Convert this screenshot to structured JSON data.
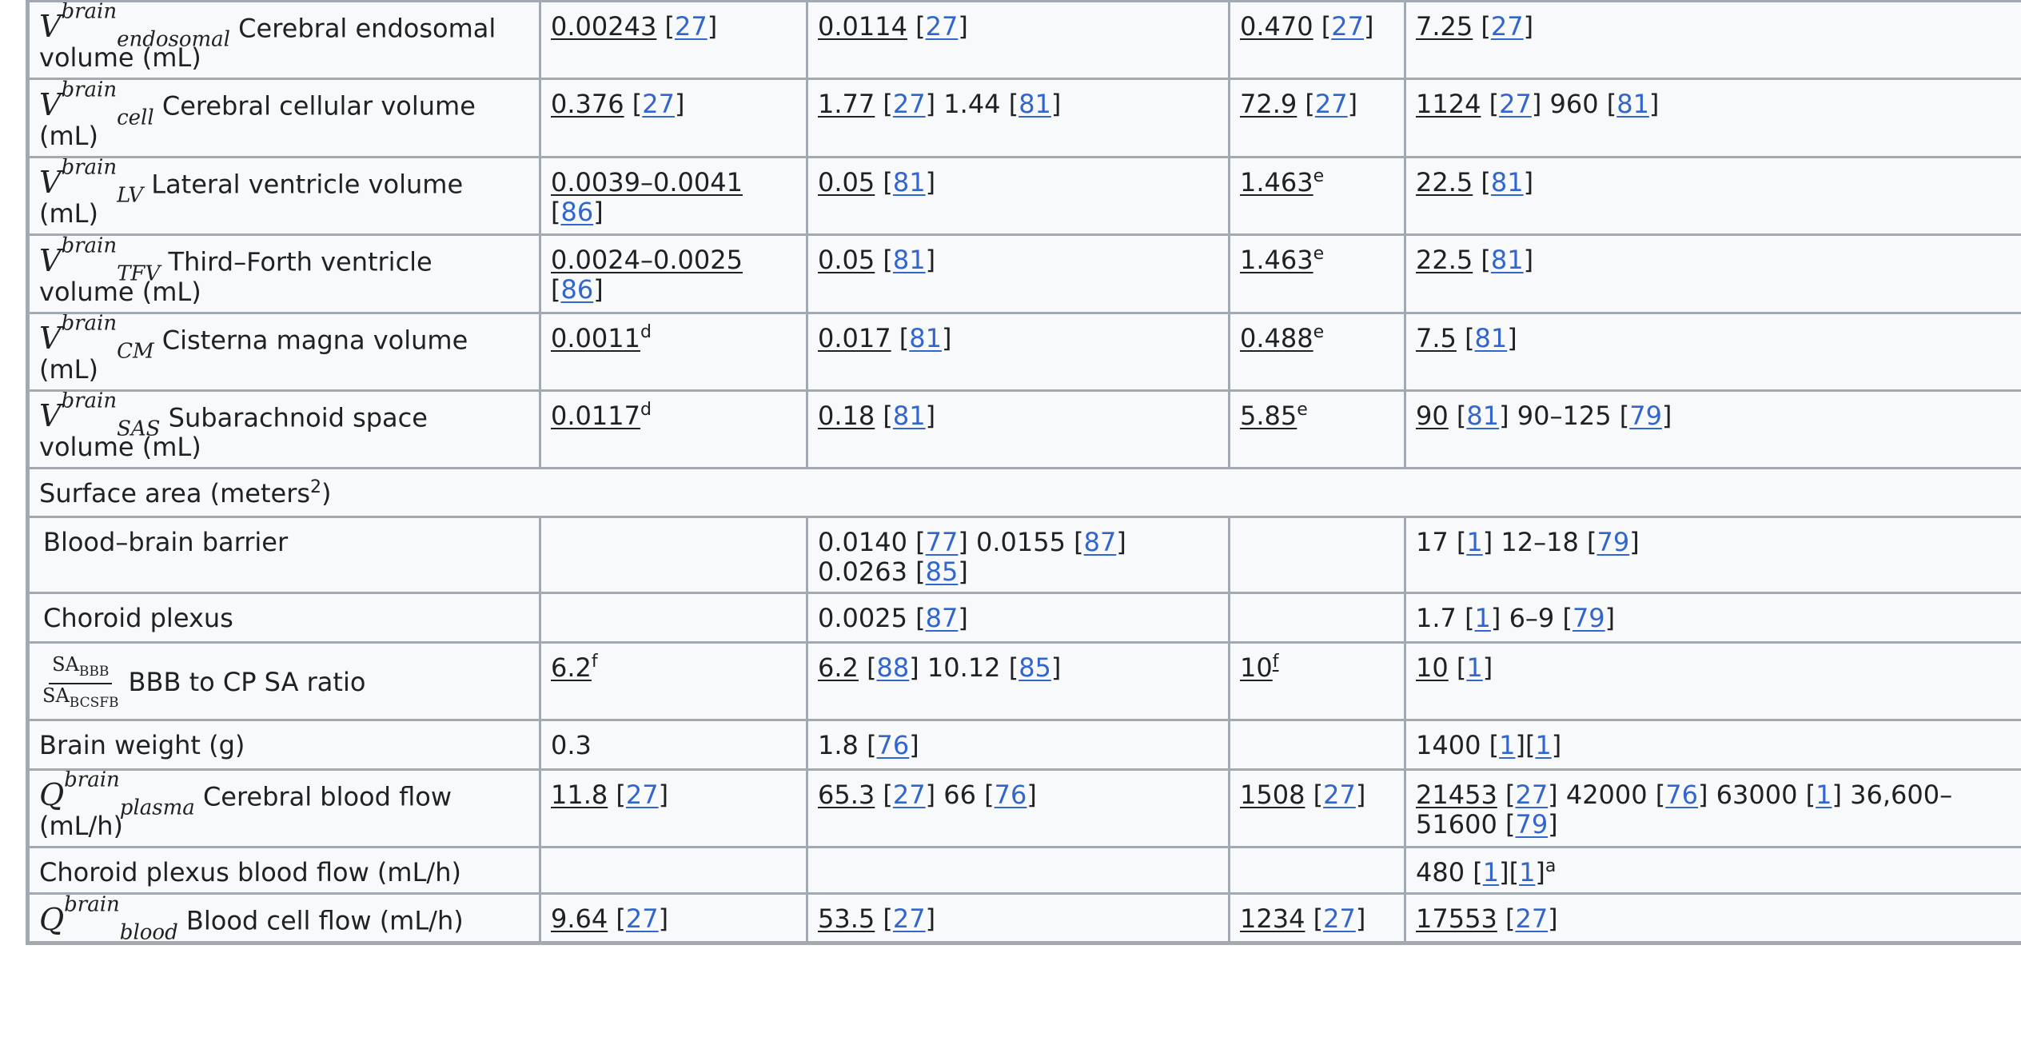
{
  "rows": [
    {
      "sym_base": "V",
      "sym_sup": "brain",
      "sym_sub": "endosomal",
      "label": "Cerebral endosomal volume (mL)",
      "cells": [
        [
          {
            "t": "0.00243",
            "u": true
          },
          {
            "t": " ["
          },
          {
            "r": "27"
          },
          {
            "t": "]"
          }
        ],
        [
          {
            "t": "0.0114",
            "u": true
          },
          {
            "t": " ["
          },
          {
            "r": "27"
          },
          {
            "t": "]"
          }
        ],
        [
          {
            "t": "0.470",
            "u": true
          },
          {
            "t": " ["
          },
          {
            "r": "27"
          },
          {
            "t": "]"
          }
        ],
        [
          {
            "t": "7.25",
            "u": true
          },
          {
            "t": " ["
          },
          {
            "r": "27"
          },
          {
            "t": "]"
          }
        ]
      ]
    },
    {
      "sym_base": "V",
      "sym_sup": "brain",
      "sym_sub": "cell",
      "label": "Cerebral cellular volume (mL)",
      "cells": [
        [
          {
            "t": "0.376",
            "u": true
          },
          {
            "t": " ["
          },
          {
            "r": "27"
          },
          {
            "t": "]"
          }
        ],
        [
          {
            "t": "1.77",
            "u": true
          },
          {
            "t": " ["
          },
          {
            "r": "27"
          },
          {
            "t": "] 1.44 ["
          },
          {
            "r": "81"
          },
          {
            "t": "]"
          }
        ],
        [
          {
            "t": "72.9",
            "u": true
          },
          {
            "t": " ["
          },
          {
            "r": "27"
          },
          {
            "t": "]"
          }
        ],
        [
          {
            "t": "1124",
            "u": true
          },
          {
            "t": " ["
          },
          {
            "r": "27"
          },
          {
            "t": "] 960 ["
          },
          {
            "r": "81"
          },
          {
            "t": "]"
          }
        ]
      ]
    },
    {
      "sym_base": "V",
      "sym_sup": "brain",
      "sym_sub": "LV",
      "label": "Lateral ventricle volume (mL)",
      "cells": [
        [
          {
            "t": "0.0039–0.0041",
            "u": true
          },
          {
            "t": " ["
          },
          {
            "r": "86"
          },
          {
            "t": "]"
          }
        ],
        [
          {
            "t": "0.05",
            "u": true
          },
          {
            "t": " ["
          },
          {
            "r": "81"
          },
          {
            "t": "]"
          }
        ],
        [
          {
            "t": "1.463",
            "u": true
          },
          {
            "s": "e"
          }
        ],
        [
          {
            "t": "22.5",
            "u": true
          },
          {
            "t": " ["
          },
          {
            "r": "81"
          },
          {
            "t": "]"
          }
        ]
      ]
    },
    {
      "sym_base": "V",
      "sym_sup": "brain",
      "sym_sub": "TFV",
      "label": "Third–Forth ventricle volume (mL)",
      "cells": [
        [
          {
            "t": "0.0024–0.0025",
            "u": true
          },
          {
            "t": " ["
          },
          {
            "r": "86"
          },
          {
            "t": "]"
          }
        ],
        [
          {
            "t": "0.05",
            "u": true
          },
          {
            "t": " ["
          },
          {
            "r": "81"
          },
          {
            "t": "]"
          }
        ],
        [
          {
            "t": "1.463",
            "u": true
          },
          {
            "s": "e"
          }
        ],
        [
          {
            "t": "22.5",
            "u": true
          },
          {
            "t": " ["
          },
          {
            "r": "81"
          },
          {
            "t": "]"
          }
        ]
      ]
    },
    {
      "sym_base": "V",
      "sym_sup": "brain",
      "sym_sub": "CM",
      "label": "Cisterna magna volume (mL)",
      "cells": [
        [
          {
            "t": "0.0011",
            "u": true
          },
          {
            "s": "d"
          }
        ],
        [
          {
            "t": "0.017",
            "u": true
          },
          {
            "t": " ["
          },
          {
            "r": "81"
          },
          {
            "t": "]"
          }
        ],
        [
          {
            "t": "0.488",
            "u": true
          },
          {
            "s": "e"
          }
        ],
        [
          {
            "t": "7.5",
            "u": true
          },
          {
            "t": " ["
          },
          {
            "r": "81"
          },
          {
            "t": "]"
          }
        ]
      ]
    },
    {
      "sym_base": "V",
      "sym_sup": "brain",
      "sym_sub": "SAS",
      "label": "Subarachnoid space volume (mL)",
      "cells": [
        [
          {
            "t": "0.0117",
            "u": true
          },
          {
            "s": "d"
          }
        ],
        [
          {
            "t": "0.18",
            "u": true
          },
          {
            "t": " ["
          },
          {
            "r": "81"
          },
          {
            "t": "]"
          }
        ],
        [
          {
            "t": "5.85",
            "u": true
          },
          {
            "s": "e"
          }
        ],
        [
          {
            "t": "90",
            "u": true
          },
          {
            "t": " ["
          },
          {
            "r": "81"
          },
          {
            "t": "] 90–125 ["
          },
          {
            "r": "79"
          },
          {
            "t": "]"
          }
        ]
      ]
    },
    {
      "section": true,
      "label_parts": [
        {
          "t": "Surface area (meters"
        },
        {
          "s": "2"
        },
        {
          "t": ")"
        }
      ]
    },
    {
      "indent": true,
      "label": "Blood–brain barrier",
      "cells": [
        [],
        [
          {
            "t": "0.0140 ["
          },
          {
            "r": "77"
          },
          {
            "t": "] 0.0155 ["
          },
          {
            "r": "87"
          },
          {
            "t": "] 0.0263 ["
          },
          {
            "r": "85"
          },
          {
            "t": "]"
          }
        ],
        [],
        [
          {
            "t": "17 ["
          },
          {
            "r": "1"
          },
          {
            "t": "] 12–18 ["
          },
          {
            "r": "79"
          },
          {
            "t": "]"
          }
        ]
      ]
    },
    {
      "indent": true,
      "label": "Choroid plexus",
      "cells": [
        [],
        [
          {
            "t": "0.0025 ["
          },
          {
            "r": "87"
          },
          {
            "t": "]"
          }
        ],
        [],
        [
          {
            "t": "1.7 ["
          },
          {
            "r": "1"
          },
          {
            "t": "] 6–9 ["
          },
          {
            "r": "79"
          },
          {
            "t": "]"
          }
        ]
      ]
    },
    {
      "frac_num": "SA",
      "frac_num_sub": "BBB",
      "frac_den": "SA",
      "frac_den_sub": "BCSFB",
      "label": "BBB to CP SA ratio",
      "cells": [
        [
          {
            "t": "6.2",
            "u": true
          },
          {
            "s": "f"
          }
        ],
        [
          {
            "t": "6.2",
            "u": true
          },
          {
            "t": " ["
          },
          {
            "r": "88"
          },
          {
            "t": "] 10.12 ["
          },
          {
            "r": "85"
          },
          {
            "t": "]"
          }
        ],
        [
          {
            "t": "10",
            "u": true
          },
          {
            "s": "f",
            "u": true
          }
        ],
        [
          {
            "t": "10",
            "u": true
          },
          {
            "t": " ["
          },
          {
            "r": "1"
          },
          {
            "t": "]"
          }
        ]
      ]
    },
    {
      "label": "Brain weight (g)",
      "cells": [
        [
          {
            "t": "0.3"
          }
        ],
        [
          {
            "t": "1.8 ["
          },
          {
            "r": "76"
          },
          {
            "t": "]"
          }
        ],
        [],
        [
          {
            "t": "1400 ["
          },
          {
            "r": "1"
          },
          {
            "t": "]["
          },
          {
            "r": "1"
          },
          {
            "t": "]"
          }
        ]
      ]
    },
    {
      "sym_base": "Q",
      "sym_sup": "brain",
      "sym_sub": "plasma",
      "label": "Cerebral blood flow (mL/h)",
      "cells": [
        [
          {
            "t": "11.8",
            "u": true
          },
          {
            "t": " ["
          },
          {
            "r": "27"
          },
          {
            "t": "]"
          }
        ],
        [
          {
            "t": "65.3",
            "u": true
          },
          {
            "t": " ["
          },
          {
            "r": "27"
          },
          {
            "t": "] 66 ["
          },
          {
            "r": "76"
          },
          {
            "t": "]"
          }
        ],
        [
          {
            "t": "1508",
            "u": true
          },
          {
            "t": " ["
          },
          {
            "r": "27"
          },
          {
            "t": "]"
          }
        ],
        [
          {
            "t": "21453",
            "u": true
          },
          {
            "t": " ["
          },
          {
            "r": "27"
          },
          {
            "t": "] 42000 ["
          },
          {
            "r": "76"
          },
          {
            "t": "] 63000 ["
          },
          {
            "r": "1"
          },
          {
            "t": "] 36,600–51600 ["
          },
          {
            "r": "79"
          },
          {
            "t": "]"
          }
        ]
      ]
    },
    {
      "label": "Choroid plexus blood flow (mL/h)",
      "cells": [
        [],
        [],
        [],
        [
          {
            "t": "480 ["
          },
          {
            "r": "1"
          },
          {
            "t": "]["
          },
          {
            "r": "1"
          },
          {
            "t": "]"
          },
          {
            "s": "a"
          }
        ]
      ]
    },
    {
      "sym_base": "Q",
      "sym_sup": "brain",
      "sym_sub": "blood",
      "label": "Blood cell flow (mL/h)",
      "cells": [
        [
          {
            "t": "9.64",
            "u": true
          },
          {
            "t": " ["
          },
          {
            "r": "27"
          },
          {
            "t": "]"
          }
        ],
        [
          {
            "t": "53.5",
            "u": true
          },
          {
            "t": " ["
          },
          {
            "r": "27"
          },
          {
            "t": "]"
          }
        ],
        [
          {
            "t": "1234",
            "u": true
          },
          {
            "t": " ["
          },
          {
            "r": "27"
          },
          {
            "t": "]"
          }
        ],
        [
          {
            "t": "17553",
            "u": true
          },
          {
            "t": " ["
          },
          {
            "r": "27"
          },
          {
            "t": "]"
          }
        ]
      ]
    }
  ],
  "colors": {
    "link": "#3366cc",
    "border": "#a2a9b1",
    "cell_bg": "#f8f9fa",
    "text": "#202122"
  }
}
